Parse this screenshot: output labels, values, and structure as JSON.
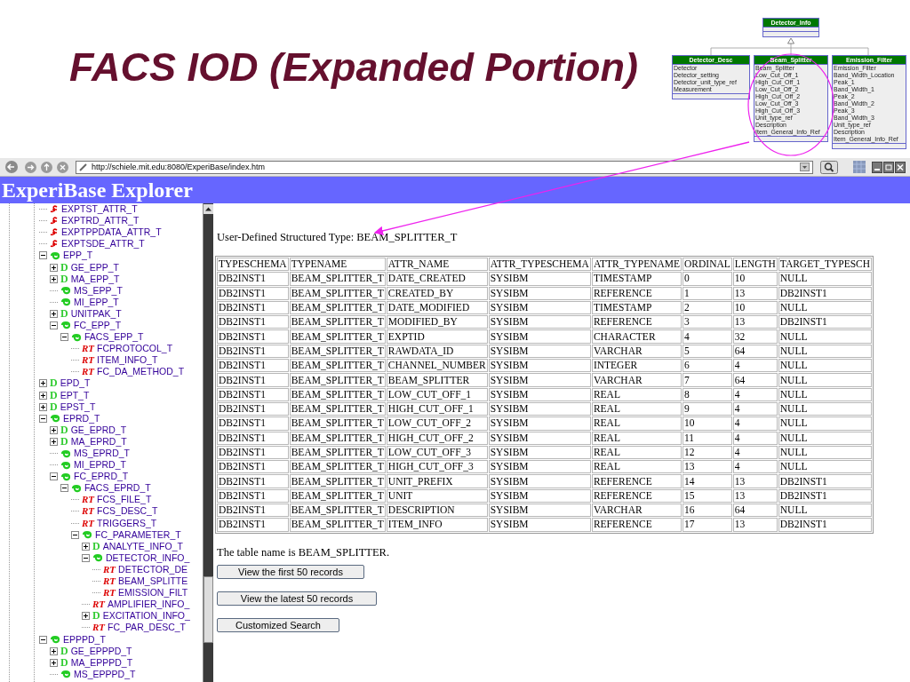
{
  "slide_title": "FACS IOD (Expanded Portion)",
  "uml": {
    "parent": {
      "name": "Detector_Info"
    },
    "classes": [
      {
        "name": "Detector_Desc",
        "attributes": [
          "Detector",
          "Detector_setting",
          "Detector_unit_type_ref",
          "Measurement"
        ]
      },
      {
        "name": "Beam_Splitter",
        "attributes": [
          "Beam_Splitter",
          "Low_Cut_Off_1",
          "High_Cut_Off_1",
          "Low_Cut_Off_2",
          "High_Cut_Off_2",
          "Low_Cut_Off_3",
          "High_Cut_Off_3",
          "Unit_type_ref",
          "Description",
          "Item_General_Info_Ref"
        ]
      },
      {
        "name": "Emission_Filter",
        "attributes": [
          "Emission_Filter",
          "Band_Width_Location",
          "Peak_1",
          "Band_Width_1",
          "Peak_2",
          "Band_Width_2",
          "Peak_3",
          "Band_Width_3",
          "Unit_type_ref",
          "Description",
          "Item_General_Info_Ref"
        ]
      }
    ]
  },
  "browser": {
    "address": "http://schiele.mit.edu:8080/ExperiBase/index.htm"
  },
  "header": {
    "title": "ExperiBase Explorer"
  },
  "tree": [
    {
      "label": "EXPTST_ATTR_T",
      "kind": "attr"
    },
    {
      "label": "EXPTRD_ATTR_T",
      "kind": "attr"
    },
    {
      "label": "EXPTPPDATA_ATTR_T",
      "kind": "attr"
    },
    {
      "label": "EXPTSDE_ATTR_T",
      "kind": "attr"
    },
    {
      "label": "EPP_T",
      "kind": "group",
      "expanded": true,
      "children": [
        {
          "label": "GE_EPP_T",
          "kind": "d",
          "badge": "D",
          "expanded": false
        },
        {
          "label": "MA_EPP_T",
          "kind": "d",
          "badge": "D",
          "expanded": false
        },
        {
          "label": "MS_EPP_T",
          "kind": "group"
        },
        {
          "label": "MI_EPP_T",
          "kind": "group"
        },
        {
          "label": "UNITPAK_T",
          "kind": "d",
          "badge": "D",
          "expanded": false
        },
        {
          "label": "FC_EPP_T",
          "kind": "group",
          "expanded": true,
          "children": [
            {
              "label": "FACS_EPP_T",
              "kind": "group",
              "expanded": true,
              "children": [
                {
                  "label": "FCPROTOCOL_T",
                  "kind": "rt",
                  "badge": "RT"
                },
                {
                  "label": "ITEM_INFO_T",
                  "kind": "rt",
                  "badge": "RT"
                },
                {
                  "label": "FC_DA_METHOD_T",
                  "kind": "rt",
                  "badge": "RT"
                }
              ]
            }
          ]
        }
      ]
    },
    {
      "label": "EPD_T",
      "kind": "d",
      "badge": "D",
      "expanded": false
    },
    {
      "label": "EPT_T",
      "kind": "d",
      "badge": "D",
      "expanded": false
    },
    {
      "label": "EPST_T",
      "kind": "d",
      "badge": "D",
      "expanded": false
    },
    {
      "label": "EPRD_T",
      "kind": "group",
      "expanded": true,
      "children": [
        {
          "label": "GE_EPRD_T",
          "kind": "d",
          "badge": "D",
          "expanded": false
        },
        {
          "label": "MA_EPRD_T",
          "kind": "d",
          "badge": "D",
          "expanded": false
        },
        {
          "label": "MS_EPRD_T",
          "kind": "group"
        },
        {
          "label": "MI_EPRD_T",
          "kind": "group"
        },
        {
          "label": "FC_EPRD_T",
          "kind": "group",
          "expanded": true,
          "children": [
            {
              "label": "FACS_EPRD_T",
              "kind": "group",
              "expanded": true,
              "children": [
                {
                  "label": "FCS_FILE_T",
                  "kind": "rt",
                  "badge": "RT"
                },
                {
                  "label": "FCS_DESC_T",
                  "kind": "rt",
                  "badge": "RT"
                },
                {
                  "label": "TRIGGERS_T",
                  "kind": "rt",
                  "badge": "RT"
                },
                {
                  "label": "FC_PARAMETER_T",
                  "kind": "group",
                  "expanded": true,
                  "children": [
                    {
                      "label": "ANALYTE_INFO_T",
                      "kind": "d",
                      "badge": "D",
                      "expanded": false
                    },
                    {
                      "label": "DETECTOR_INFO_",
                      "kind": "group",
                      "expanded": true,
                      "children": [
                        {
                          "label": "DETECTOR_DE",
                          "kind": "rt",
                          "badge": "RT"
                        },
                        {
                          "label": "BEAM_SPLITTE",
                          "kind": "rt",
                          "badge": "RT"
                        },
                        {
                          "label": "EMISSION_FILT",
                          "kind": "rt",
                          "badge": "RT"
                        }
                      ]
                    },
                    {
                      "label": "AMPLIFIER_INFO_",
                      "kind": "rt",
                      "badge": "RT"
                    },
                    {
                      "label": "EXCITATION_INFO_",
                      "kind": "d",
                      "badge": "D",
                      "expanded": false
                    },
                    {
                      "label": "FC_PAR_DESC_T",
                      "kind": "rt",
                      "badge": "RT"
                    }
                  ]
                }
              ]
            }
          ]
        }
      ]
    },
    {
      "label": "EPPPD_T",
      "kind": "group",
      "expanded": true,
      "children": [
        {
          "label": "GE_EPPPD_T",
          "kind": "d",
          "badge": "D",
          "expanded": false
        },
        {
          "label": "MA_EPPPD_T",
          "kind": "d",
          "badge": "D",
          "expanded": false
        },
        {
          "label": "MS_EPPPD_T",
          "kind": "group"
        }
      ]
    }
  ],
  "content": {
    "caption": "User-Defined Structured Type: BEAM_SPLITTER_T",
    "table": {
      "columns": [
        "TYPESCHEMA",
        "TYPENAME",
        "ATTR_NAME",
        "ATTR_TYPESCHEMA",
        "ATTR_TYPENAME",
        "ORDINAL",
        "LENGTH",
        "TARGET_TYPESCH"
      ],
      "rows": [
        [
          "DB2INST1",
          "BEAM_SPLITTER_T",
          "DATE_CREATED",
          "SYSIBM",
          "TIMESTAMP",
          "0",
          "10",
          "NULL"
        ],
        [
          "DB2INST1",
          "BEAM_SPLITTER_T",
          "CREATED_BY",
          "SYSIBM",
          "REFERENCE",
          "1",
          "13",
          "DB2INST1"
        ],
        [
          "DB2INST1",
          "BEAM_SPLITTER_T",
          "DATE_MODIFIED",
          "SYSIBM",
          "TIMESTAMP",
          "2",
          "10",
          "NULL"
        ],
        [
          "DB2INST1",
          "BEAM_SPLITTER_T",
          "MODIFIED_BY",
          "SYSIBM",
          "REFERENCE",
          "3",
          "13",
          "DB2INST1"
        ],
        [
          "DB2INST1",
          "BEAM_SPLITTER_T",
          "EXPTID",
          "SYSIBM",
          "CHARACTER",
          "4",
          "32",
          "NULL"
        ],
        [
          "DB2INST1",
          "BEAM_SPLITTER_T",
          "RAWDATA_ID",
          "SYSIBM",
          "VARCHAR",
          "5",
          "64",
          "NULL"
        ],
        [
          "DB2INST1",
          "BEAM_SPLITTER_T",
          "CHANNEL_NUMBER",
          "SYSIBM",
          "INTEGER",
          "6",
          "4",
          "NULL"
        ],
        [
          "DB2INST1",
          "BEAM_SPLITTER_T",
          "BEAM_SPLITTER",
          "SYSIBM",
          "VARCHAR",
          "7",
          "64",
          "NULL"
        ],
        [
          "DB2INST1",
          "BEAM_SPLITTER_T",
          "LOW_CUT_OFF_1",
          "SYSIBM",
          "REAL",
          "8",
          "4",
          "NULL"
        ],
        [
          "DB2INST1",
          "BEAM_SPLITTER_T",
          "HIGH_CUT_OFF_1",
          "SYSIBM",
          "REAL",
          "9",
          "4",
          "NULL"
        ],
        [
          "DB2INST1",
          "BEAM_SPLITTER_T",
          "LOW_CUT_OFF_2",
          "SYSIBM",
          "REAL",
          "10",
          "4",
          "NULL"
        ],
        [
          "DB2INST1",
          "BEAM_SPLITTER_T",
          "HIGH_CUT_OFF_2",
          "SYSIBM",
          "REAL",
          "11",
          "4",
          "NULL"
        ],
        [
          "DB2INST1",
          "BEAM_SPLITTER_T",
          "LOW_CUT_OFF_3",
          "SYSIBM",
          "REAL",
          "12",
          "4",
          "NULL"
        ],
        [
          "DB2INST1",
          "BEAM_SPLITTER_T",
          "HIGH_CUT_OFF_3",
          "SYSIBM",
          "REAL",
          "13",
          "4",
          "NULL"
        ],
        [
          "DB2INST1",
          "BEAM_SPLITTER_T",
          "UNIT_PREFIX",
          "SYSIBM",
          "REFERENCE",
          "14",
          "13",
          "DB2INST1"
        ],
        [
          "DB2INST1",
          "BEAM_SPLITTER_T",
          "UNIT",
          "SYSIBM",
          "REFERENCE",
          "15",
          "13",
          "DB2INST1"
        ],
        [
          "DB2INST1",
          "BEAM_SPLITTER_T",
          "DESCRIPTION",
          "SYSIBM",
          "VARCHAR",
          "16",
          "64",
          "NULL"
        ],
        [
          "DB2INST1",
          "BEAM_SPLITTER_T",
          "ITEM_INFO",
          "SYSIBM",
          "REFERENCE",
          "17",
          "13",
          "DB2INST1"
        ]
      ]
    },
    "note": "The table name is BEAM_SPLITTER.",
    "buttons": [
      "View the first 50 records",
      "View the latest 50 records",
      "Customized Search"
    ]
  }
}
